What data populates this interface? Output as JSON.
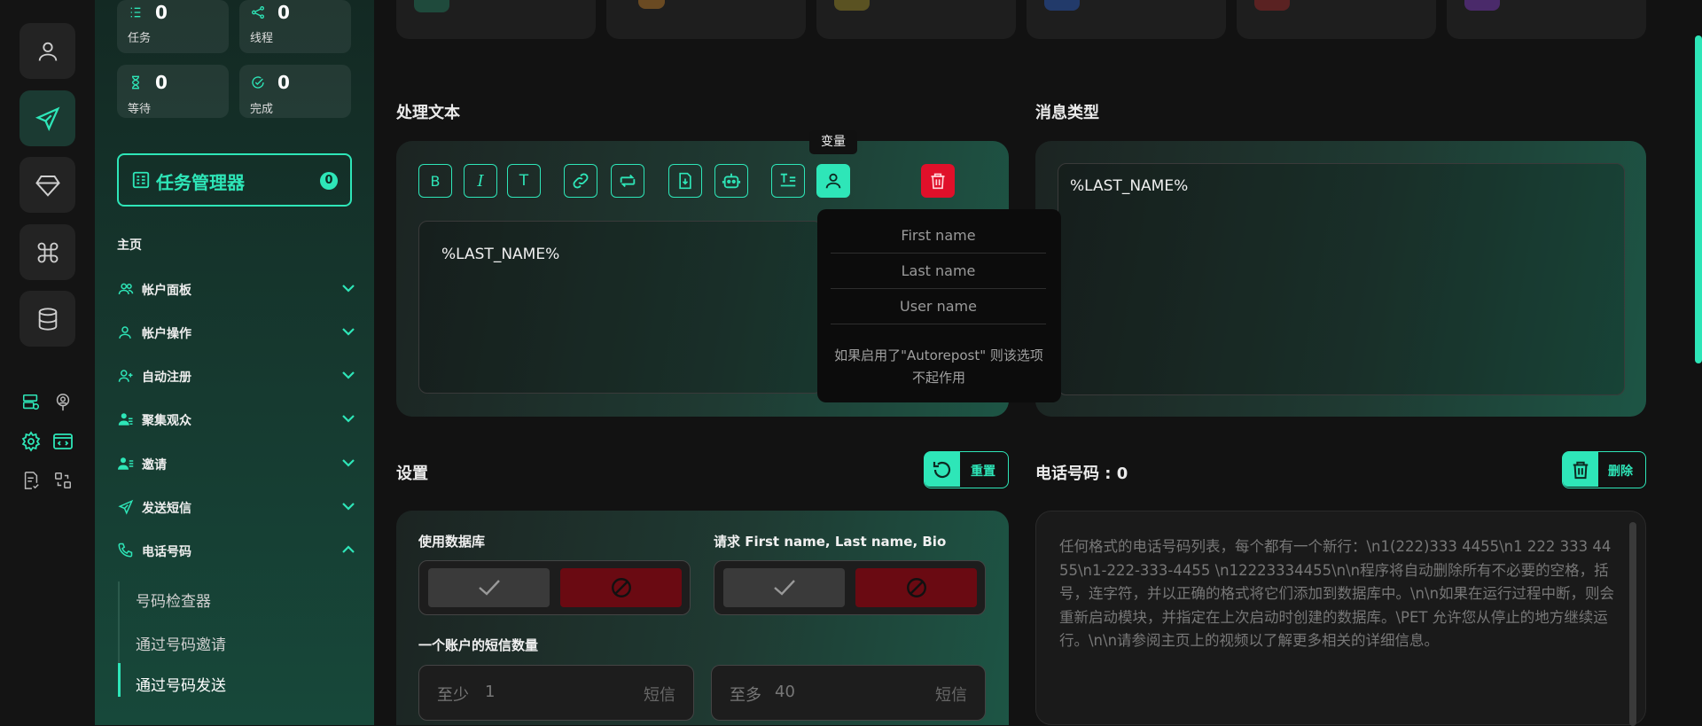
{
  "stats": [
    {
      "icon": "tasks-icon",
      "value": "0",
      "label": "任务"
    },
    {
      "icon": "threads-icon",
      "value": "0",
      "label": "线程"
    },
    {
      "icon": "hourglass-icon",
      "value": "0",
      "label": "等待"
    },
    {
      "icon": "check-circle-icon",
      "value": "0",
      "label": "完成"
    }
  ],
  "task_manager": {
    "label": "任务管理器",
    "count": "0"
  },
  "sidebar": {
    "home": "主页",
    "items": [
      {
        "label": "帐户面板",
        "icon": "users-icon"
      },
      {
        "label": "帐户操作",
        "icon": "user-icon"
      },
      {
        "label": "自动注册",
        "icon": "user-plus-icon"
      },
      {
        "label": "聚集观众",
        "icon": "user-group-icon"
      },
      {
        "label": "邀请",
        "icon": "user-list-icon"
      },
      {
        "label": "发送短信",
        "icon": "send-icon"
      },
      {
        "label": "电话号码",
        "icon": "phone-icon"
      }
    ],
    "subitems": [
      "号码检查器",
      "通过号码邀请",
      "通过号码发送"
    ]
  },
  "process_text": {
    "title": "处理文本",
    "tooltip": "变量",
    "content": "%LAST_NAME%",
    "variables": [
      "First name",
      "Last name",
      "User name"
    ],
    "note": "如果启用了\"Autorepost\" 则该选项不起作用"
  },
  "message_type": {
    "title": "消息类型",
    "content": "%LAST_NAME%"
  },
  "settings": {
    "title": "设置",
    "reset_label": "重置",
    "use_db_label": "使用数据库",
    "request_label": "请求 First name, Last name, Bio",
    "sms_count_label": "一个账户的短信数量",
    "min": {
      "prefix": "至少",
      "value": "1",
      "suffix": "短信"
    },
    "max": {
      "prefix": "至多",
      "value": "40",
      "suffix": "短信"
    }
  },
  "phones": {
    "title": "电话号码 : 0",
    "delete_label": "删除",
    "placeholder": "任何格式的电话号码列表，每个都有一个新行：\\n1(222)333 4455\\n1 222 333 4455\\n1-222-333-4455 \\n12223334455\\n\\n程序将自动删除所有不必要的空格，括号，连字符，并以正确的格式将它们添加到数据库中。\\n\\n如果在运行过程中断，则会重新启动模块，并指定在上次启动时创建的数据库。\\PET 允许您从停止的地方继续运行。\\n\\n请参阅主页上的视频以了解更多相关的详细信息。"
  },
  "colors": {
    "accent": "#2ee6b8",
    "danger": "#e0102a",
    "danger_dark": "#6a0a12"
  }
}
